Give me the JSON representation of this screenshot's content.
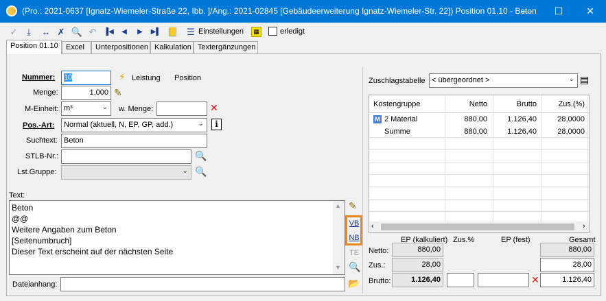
{
  "window": {
    "title": "(Pro.: 2021-0637 [Ignatz-Wiemeler-Straße 22, Ibb. ]/Ang.: 2021-02845 [Gebäudeerweiterung Ignatz-Wiemeler-Str. 22]) Position 01.10 - Beton",
    "minimize": "—",
    "maximize": "☐",
    "close": "✕"
  },
  "toolbar": {
    "settings_label": "Einstellungen",
    "done_label": "erledigt"
  },
  "tabs": [
    "Position 01.10",
    "Excel",
    "Unterpositionen",
    "Kalkulation",
    "Textergänzungen"
  ],
  "form": {
    "nummer_label": "Nummer:",
    "nummer_value": "10",
    "leistung_label": "Leistung",
    "position_label": "Position",
    "menge_label": "Menge:",
    "menge_value": "1,000",
    "meinheit_label": "M-Einheit:",
    "meinheit_value": "m³",
    "wmenge_label": "w. Menge:",
    "wmenge_value": "",
    "posart_label": "Pos.-Art:",
    "posart_value": "Normal (aktuell, N, EP, GP, add.)",
    "suchtext_label": "Suchtext:",
    "suchtext_value": "Beton",
    "stlb_label": "STLB-Nr.:",
    "stlb_value": "",
    "lstgruppe_label": "Lst.Gruppe:",
    "lstgruppe_value": ""
  },
  "text": {
    "label": "Text:",
    "lines": [
      "Beton",
      "@@",
      "Weitere Angaben zum Beton",
      "[Seitenumbruch]",
      "Dieser Text erscheint auf der nächsten Seite"
    ],
    "vb": "VB",
    "nb": "NB",
    "te": "TE"
  },
  "attachment": {
    "label": "Dateianhang:",
    "value": ""
  },
  "zuschlag": {
    "label": "Zuschlagstabelle",
    "value": "< übergeordnet >"
  },
  "grid": {
    "headers": [
      "Kostengruppe",
      "Netto",
      "Brutto",
      "Zus.(%)"
    ],
    "rows": [
      {
        "badge": "M",
        "name": "2 Material",
        "netto": "880,00",
        "brutto": "1.126,40",
        "zus": "28,0000"
      },
      {
        "badge": "",
        "name": "Summe",
        "netto": "880,00",
        "brutto": "1.126,40",
        "zus": "28,0000"
      }
    ]
  },
  "summary": {
    "col_ep_kalk": "EP (kalkuliert)",
    "col_zus": "Zus.%",
    "col_ep_fest": "EP (fest)",
    "col_gesamt": "Gesamt",
    "netto_label": "Netto:",
    "zus_label": "Zus.:",
    "brutto_label": "Brutto:",
    "netto_kalk": "880,00",
    "netto_gesamt": "880,00",
    "zus_kalk": "28,00",
    "zus_gesamt": "28,00",
    "brutto_kalk": "1.126,40",
    "brutto_gesamt": "1.126,40",
    "zus_pct": "",
    "ep_fest": ""
  }
}
